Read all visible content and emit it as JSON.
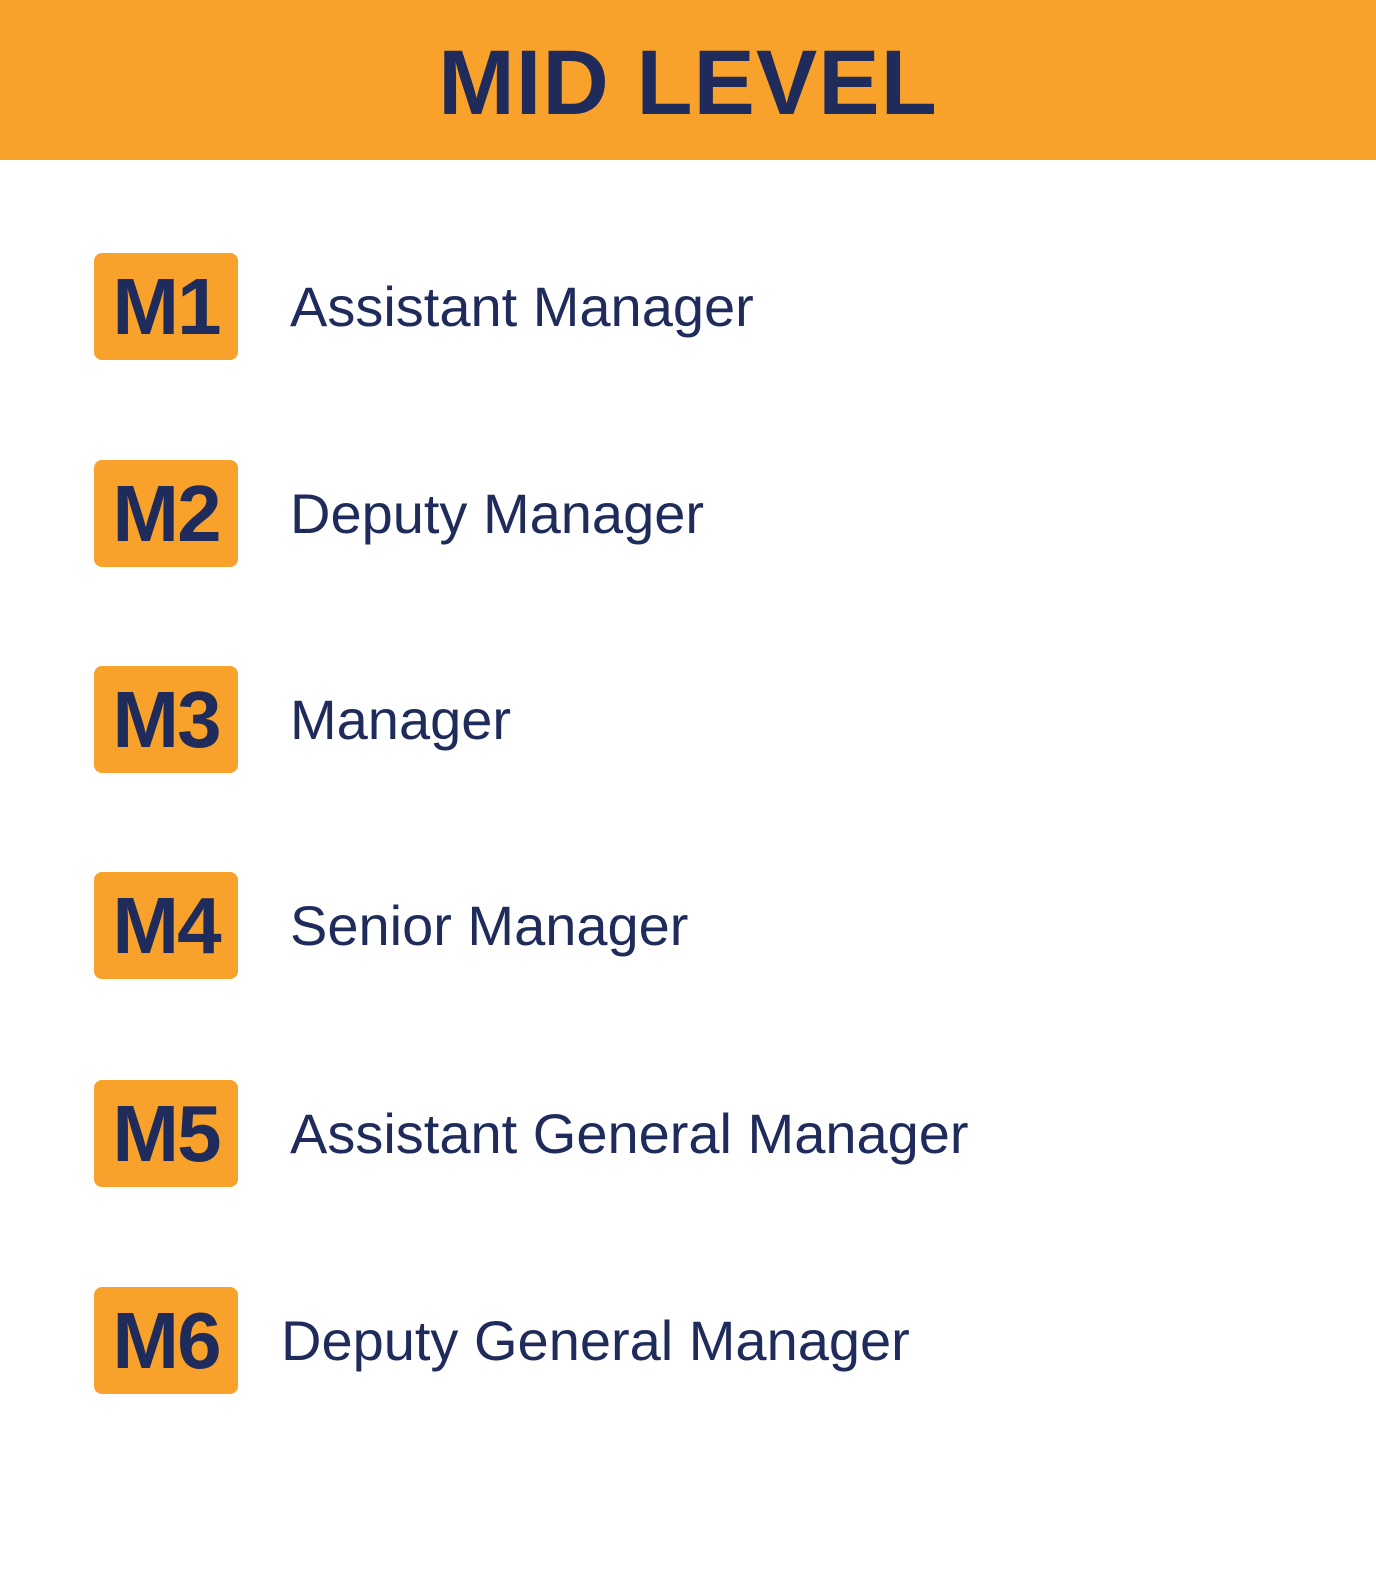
{
  "header": {
    "title": "MID LEVEL"
  },
  "levels": [
    {
      "code": "M1",
      "title": "Assistant Manager"
    },
    {
      "code": "M2",
      "title": "Deputy Manager"
    },
    {
      "code": "M3",
      "title": "Manager"
    },
    {
      "code": "M4",
      "title": "Senior Manager"
    },
    {
      "code": "M5",
      "title": "Assistant General Manager"
    },
    {
      "code": "M6",
      "title": "Deputy General Manager"
    }
  ],
  "colors": {
    "accent": "#F9A22B",
    "text": "#1F2B5B",
    "background": "#FFFFFF"
  }
}
